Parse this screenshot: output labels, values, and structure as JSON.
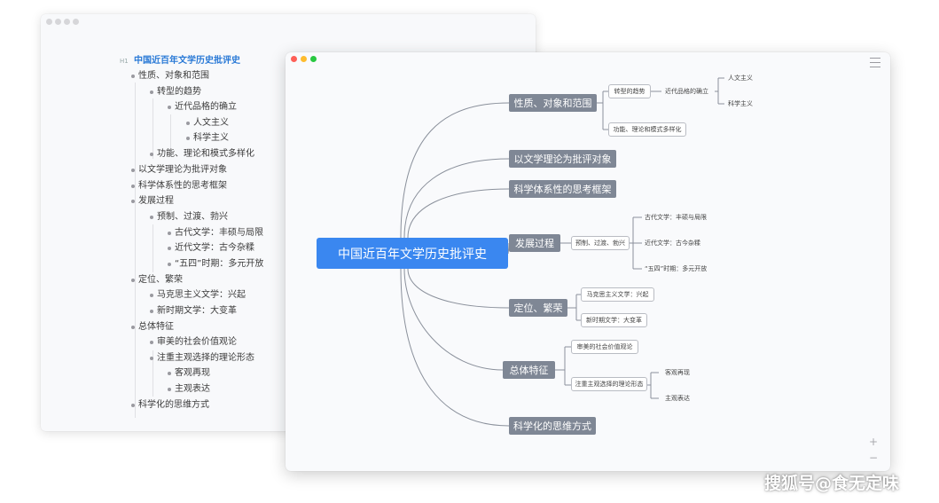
{
  "outline": {
    "heading_tag": "H1",
    "title": "中国近百年文学历史批评史",
    "items": [
      "性质、对象和范围",
      "转型的趋势",
      "近代品格的确立",
      "人文主义",
      "科学主义",
      "功能、理论和模式多样化",
      "以文学理论为批评对象",
      "科学体系性的思考框架",
      "发展过程",
      "预制、过渡、勃兴",
      "古代文学：丰硕与局限",
      "近代文学：古今杂糅",
      "“五四”时期：多元开放",
      "定位、繁荣",
      "马克思主义文学：兴起",
      "新时期文学：大变革",
      "总体特征",
      "审美的社会价值观论",
      "注重主观选择的理论形态",
      "客观再现",
      "主观表达",
      "科学化的思维方式"
    ]
  },
  "mindmap": {
    "root": "中国近百年文学历史批评史",
    "branches": [
      "性质、对象和范围",
      "以文学理论为批评对象",
      "科学体系性的思考框架",
      "发展过程",
      "定位、繁荣",
      "总体特征",
      "科学化的思维方式"
    ],
    "sub": {
      "transform": "转型的趋势",
      "modern": "近代品格的确立",
      "humanism": "人文主义",
      "science": "科学主义",
      "function": "功能、理论和模式多样化",
      "prep": "预制、过渡、勃兴",
      "ancient": "古代文学：丰硕与局限",
      "neo": "近代文学：古今杂糅",
      "maysfourth": "“五四”时期：多元开放",
      "marx": "马克思主义文学：兴起",
      "newera": "新时期文学：大变革",
      "aesthetic": "审美的社会价值观论",
      "subjective": "注重主观选择的理论形态",
      "objective": "客观再现",
      "express": "主观表达"
    },
    "zoom_in": "+",
    "zoom_out": "−"
  },
  "watermark": "搜狐号@食无定味",
  "colors": {
    "root": "#3a87f0",
    "branch": "#7f8795",
    "link": "#2979d6",
    "line": "#8a909b"
  }
}
